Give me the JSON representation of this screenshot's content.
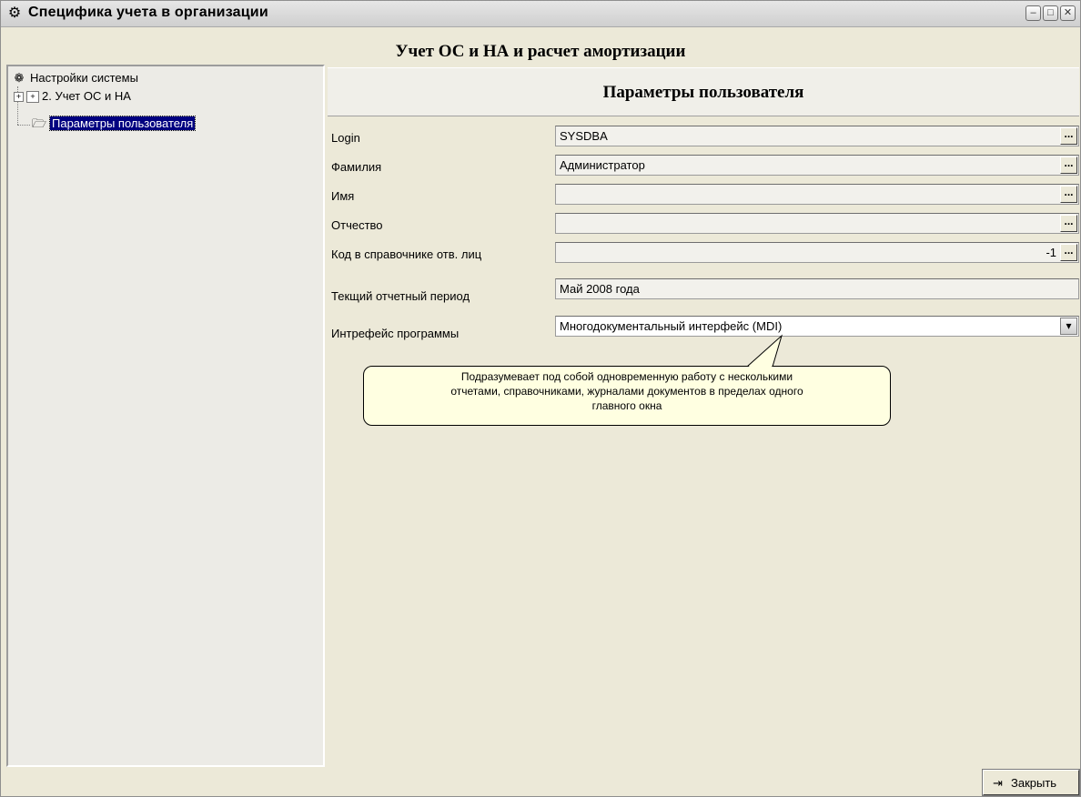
{
  "window": {
    "title": "Специфика учета в организации",
    "app_icon": "gear-computer-icon",
    "controls": {
      "minimize": "–",
      "maximize": "□",
      "close": "✕"
    }
  },
  "module_title": "Учет ОС и НА и расчет амортизации",
  "tree": {
    "root": {
      "label": "Настройки системы",
      "icon": "settings-icon"
    },
    "items": [
      {
        "label": "2. Учет ОС и НА",
        "icon": "folder-closed-icon"
      },
      {
        "label": "Параметры пользователя",
        "icon": "folder-open-icon"
      }
    ]
  },
  "panel": {
    "header": "Параметры пользователя",
    "fields": [
      {
        "label": "Login",
        "value": "SYSDBA"
      },
      {
        "label": "Фамилия",
        "value": "Администратор"
      },
      {
        "label": "Имя",
        "value": ""
      },
      {
        "label": "Отчество",
        "value": ""
      },
      {
        "label": "Код в справочнике отв. лиц",
        "value": "-1"
      },
      {
        "label": "Текщий отчетный период",
        "value": "Май 2008 года"
      },
      {
        "label": "Интрефейс программы",
        "value": "Многодокументальный интерфейс (MDI)"
      }
    ],
    "dots_label": "...",
    "select_arrow": "▾"
  },
  "tooltip": {
    "line1": "Подразумевает под собой одновременную работу с несколькими",
    "line2": "отчетами, справочниками, журналами документов в пределах одного",
    "line3": "главного окна"
  },
  "close_button": {
    "label": "Закрыть",
    "icon": "exit-door-icon"
  }
}
